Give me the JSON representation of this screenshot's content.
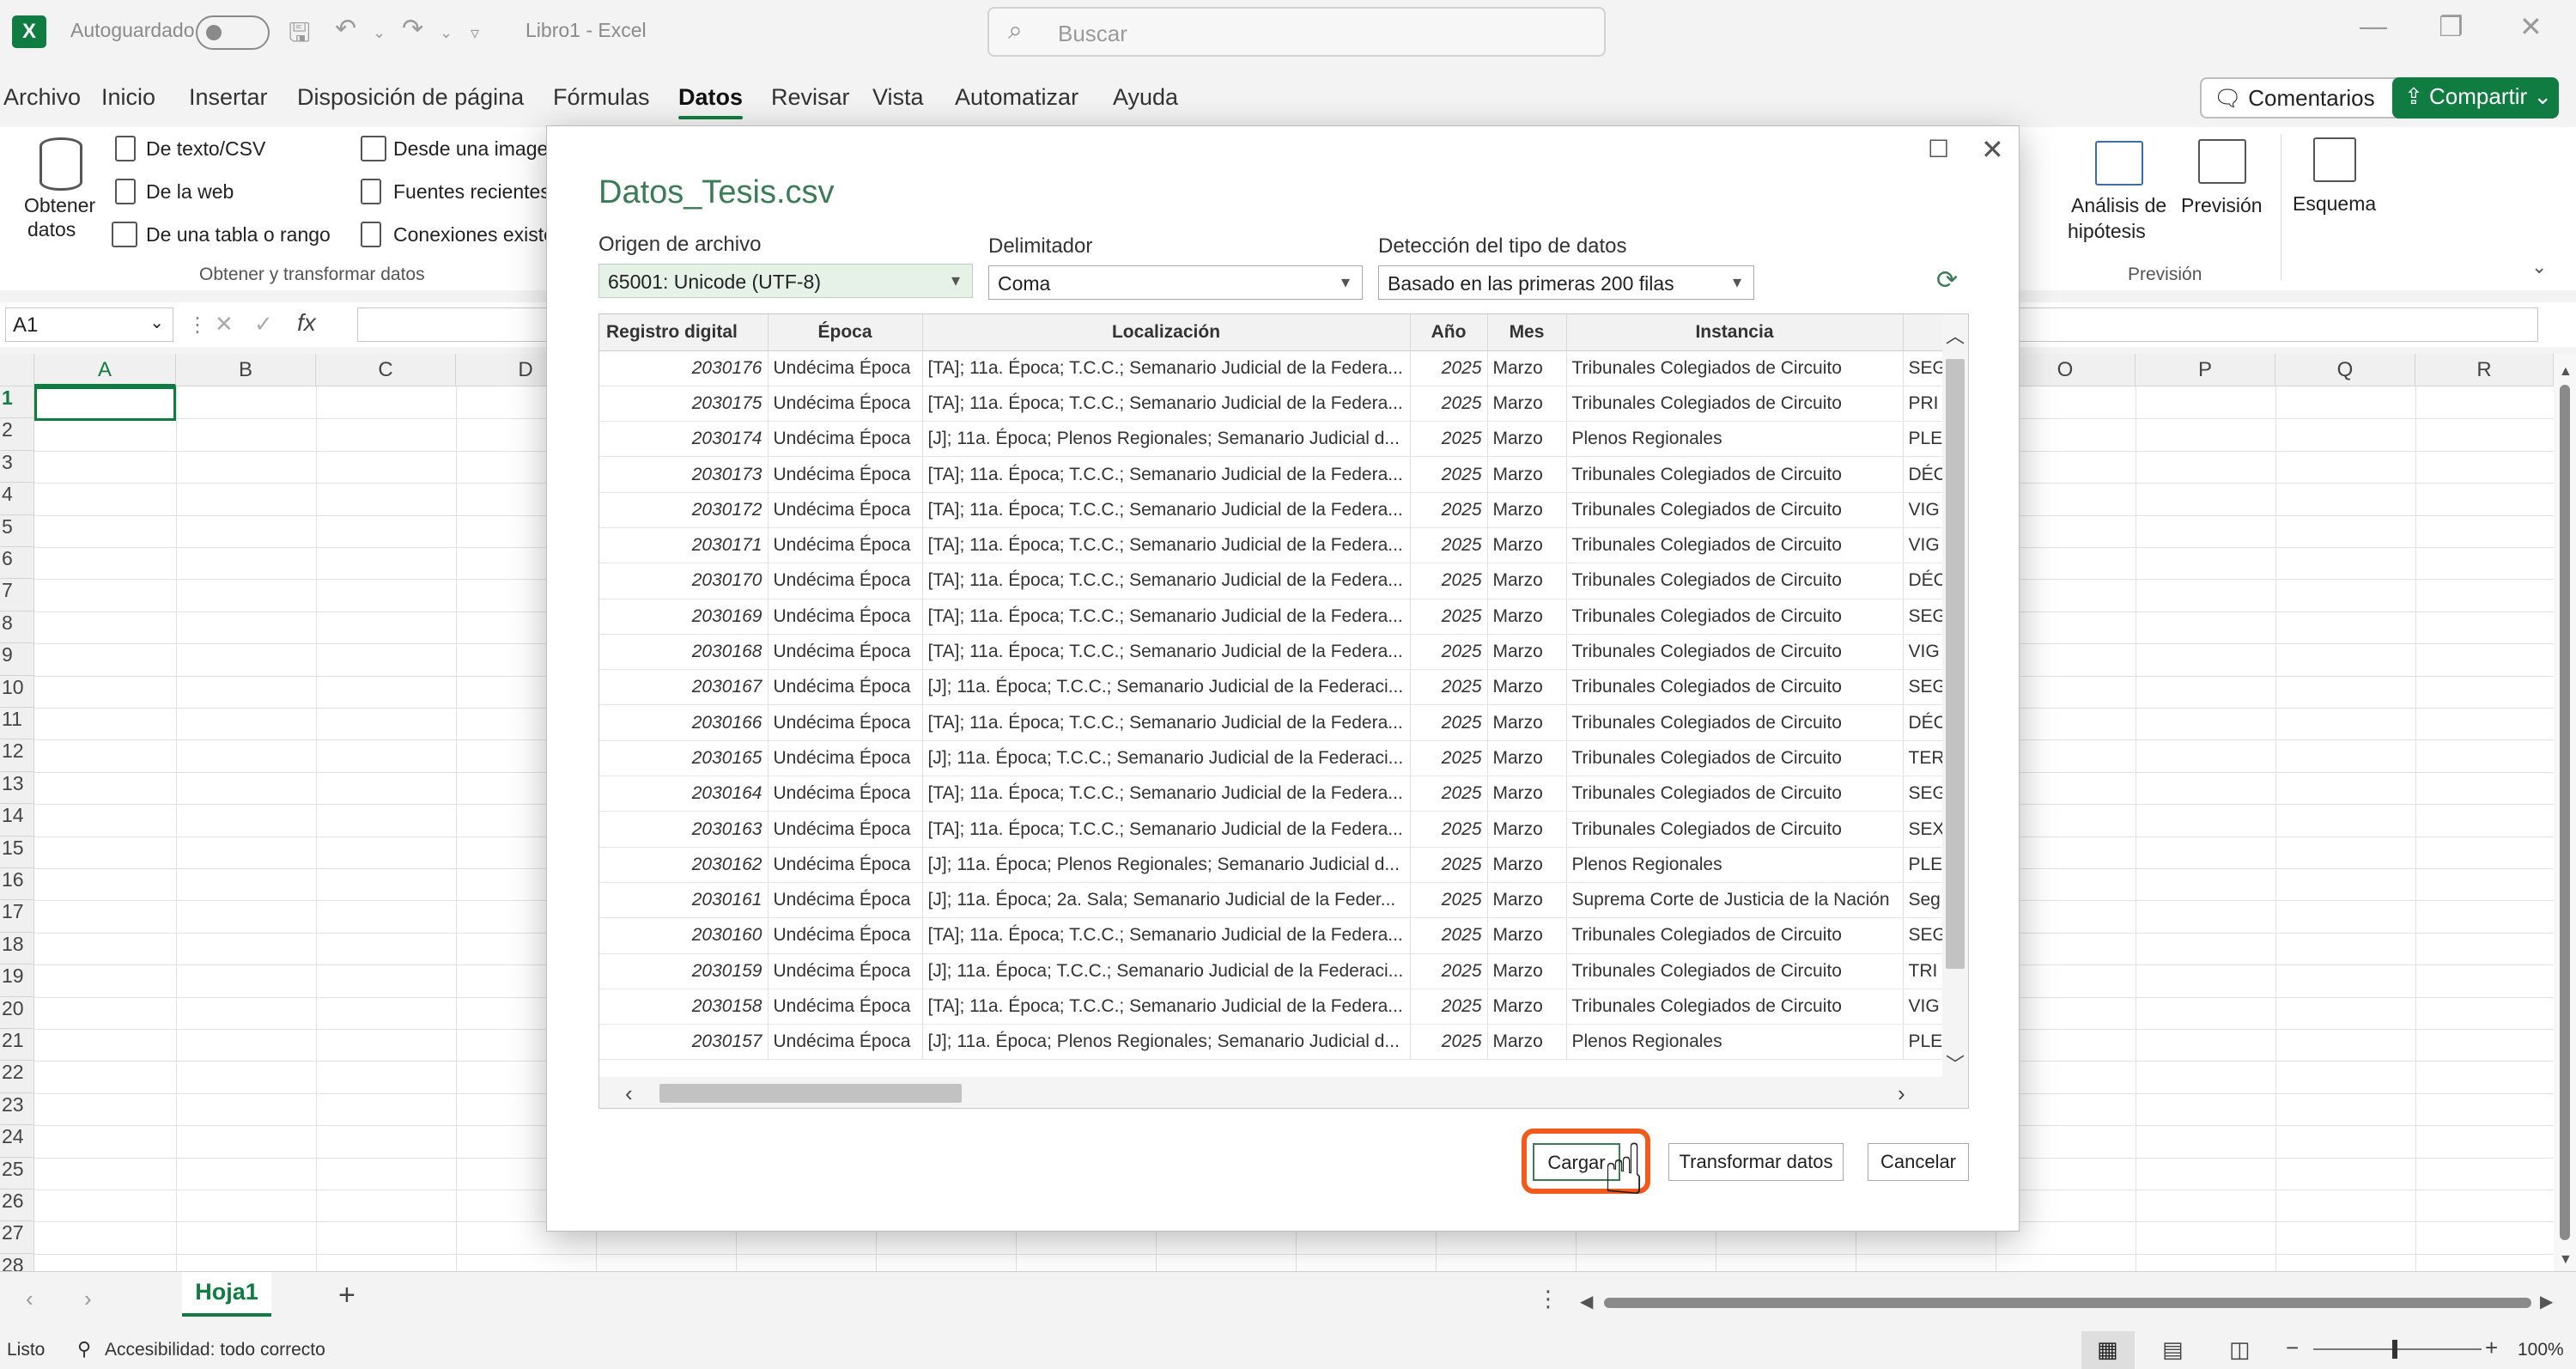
{
  "titlebar": {
    "autosave_label": "Autoguardado",
    "doc_title": "Libro1  -  Excel",
    "search_placeholder": "Buscar",
    "logo": "X"
  },
  "tabs": [
    "Archivo",
    "Inicio",
    "Insertar",
    "Disposición de página",
    "Fórmulas",
    "Datos",
    "Revisar",
    "Vista",
    "Automatizar",
    "Ayuda"
  ],
  "active_tab": "Datos",
  "header_buttons": {
    "comments": "Comentarios",
    "share": "Compartir"
  },
  "ribbon": {
    "get_data": "Obtener",
    "get_data2": "datos",
    "from_text": "De texto/CSV",
    "from_web": "De la web",
    "from_table": "De una tabla o rango",
    "from_image": "Desde una imagen",
    "recent_sources": "Fuentes recientes",
    "existing_conn": "Conexiones existentes",
    "group_get": "Obtener y transformar datos",
    "whatif": "Análisis de",
    "whatif2": "hipótesis",
    "forecast": "Previsión",
    "outline": "Esquema",
    "group_forecast": "Previsión"
  },
  "formula_bar": {
    "namebox": "A1",
    "fx": "fx"
  },
  "grid": {
    "columns": [
      "A",
      "B",
      "C",
      "D",
      "O",
      "P",
      "Q",
      "R"
    ],
    "rows": [
      "1",
      "2",
      "3",
      "4",
      "5",
      "6",
      "7",
      "8",
      "9",
      "10",
      "11",
      "12",
      "13",
      "14",
      "15",
      "16",
      "17",
      "18",
      "19",
      "20",
      "21",
      "22",
      "23",
      "24",
      "25",
      "26",
      "27",
      "28"
    ]
  },
  "sheetbar": {
    "sheet": "Hoja1",
    "add": "+"
  },
  "statusbar": {
    "ready": "Listo",
    "accessibility": "Accesibilidad: todo correcto",
    "zoom": "100%"
  },
  "dialog": {
    "title": "Datos_Tesis.csv",
    "origin_label": "Origen de archivo",
    "origin_value": "65001: Unicode (UTF-8)",
    "delim_label": "Delimitador",
    "delim_value": "Coma",
    "detect_label": "Detección del tipo de datos",
    "detect_value": "Basado en las primeras 200 filas",
    "columns": [
      "Registro digital",
      "Época",
      "Localización",
      "Año",
      "Mes",
      "Instancia",
      ""
    ],
    "rows": [
      [
        "2030176",
        "Undécima Época",
        "[TA]; 11a. Época; T.C.C.; Semanario Judicial de la Federa...",
        "2025",
        "Marzo",
        "Tribunales Colegiados de Circuito",
        "SEG"
      ],
      [
        "2030175",
        "Undécima Época",
        "[TA]; 11a. Época; T.C.C.; Semanario Judicial de la Federa...",
        "2025",
        "Marzo",
        "Tribunales Colegiados de Circuito",
        "PRI"
      ],
      [
        "2030174",
        "Undécima Época",
        "[J]; 11a. Época; Plenos Regionales; Semanario Judicial d...",
        "2025",
        "Marzo",
        "Plenos Regionales",
        "PLE"
      ],
      [
        "2030173",
        "Undécima Época",
        "[TA]; 11a. Época; T.C.C.; Semanario Judicial de la Federa...",
        "2025",
        "Marzo",
        "Tribunales Colegiados de Circuito",
        "DÉC"
      ],
      [
        "2030172",
        "Undécima Época",
        "[TA]; 11a. Época; T.C.C.; Semanario Judicial de la Federa...",
        "2025",
        "Marzo",
        "Tribunales Colegiados de Circuito",
        "VIG"
      ],
      [
        "2030171",
        "Undécima Época",
        "[TA]; 11a. Época; T.C.C.; Semanario Judicial de la Federa...",
        "2025",
        "Marzo",
        "Tribunales Colegiados de Circuito",
        "VIG"
      ],
      [
        "2030170",
        "Undécima Época",
        "[TA]; 11a. Época; T.C.C.; Semanario Judicial de la Federa...",
        "2025",
        "Marzo",
        "Tribunales Colegiados de Circuito",
        "DÉC"
      ],
      [
        "2030169",
        "Undécima Época",
        "[TA]; 11a. Época; T.C.C.; Semanario Judicial de la Federa...",
        "2025",
        "Marzo",
        "Tribunales Colegiados de Circuito",
        "SEG"
      ],
      [
        "2030168",
        "Undécima Época",
        "[TA]; 11a. Época; T.C.C.; Semanario Judicial de la Federa...",
        "2025",
        "Marzo",
        "Tribunales Colegiados de Circuito",
        "VIG"
      ],
      [
        "2030167",
        "Undécima Época",
        "[J]; 11a. Época; T.C.C.; Semanario Judicial de la Federaci...",
        "2025",
        "Marzo",
        "Tribunales Colegiados de Circuito",
        "SEG"
      ],
      [
        "2030166",
        "Undécima Época",
        "[TA]; 11a. Época; T.C.C.; Semanario Judicial de la Federa...",
        "2025",
        "Marzo",
        "Tribunales Colegiados de Circuito",
        "DÉC"
      ],
      [
        "2030165",
        "Undécima Época",
        "[J]; 11a. Época; T.C.C.; Semanario Judicial de la Federaci...",
        "2025",
        "Marzo",
        "Tribunales Colegiados de Circuito",
        "TER"
      ],
      [
        "2030164",
        "Undécima Época",
        "[TA]; 11a. Época; T.C.C.; Semanario Judicial de la Federa...",
        "2025",
        "Marzo",
        "Tribunales Colegiados de Circuito",
        "SEG"
      ],
      [
        "2030163",
        "Undécima Época",
        "[TA]; 11a. Época; T.C.C.; Semanario Judicial de la Federa...",
        "2025",
        "Marzo",
        "Tribunales Colegiados de Circuito",
        "SEX"
      ],
      [
        "2030162",
        "Undécima Época",
        "[J]; 11a. Época; Plenos Regionales; Semanario Judicial d...",
        "2025",
        "Marzo",
        "Plenos Regionales",
        "PLE"
      ],
      [
        "2030161",
        "Undécima Época",
        "[J]; 11a. Época; 2a. Sala; Semanario Judicial de la Feder...",
        "2025",
        "Marzo",
        "Suprema Corte de Justicia de la Nación",
        "Seg"
      ],
      [
        "2030160",
        "Undécima Época",
        "[TA]; 11a. Época; T.C.C.; Semanario Judicial de la Federa...",
        "2025",
        "Marzo",
        "Tribunales Colegiados de Circuito",
        "SEG"
      ],
      [
        "2030159",
        "Undécima Época",
        "[J]; 11a. Época; T.C.C.; Semanario Judicial de la Federaci...",
        "2025",
        "Marzo",
        "Tribunales Colegiados de Circuito",
        "TRI"
      ],
      [
        "2030158",
        "Undécima Época",
        "[TA]; 11a. Época; T.C.C.; Semanario Judicial de la Federa...",
        "2025",
        "Marzo",
        "Tribunales Colegiados de Circuito",
        "VIG"
      ],
      [
        "2030157",
        "Undécima Época",
        "[J]; 11a. Época; Plenos Regionales; Semanario Judicial d...",
        "2025",
        "Marzo",
        "Plenos Regionales",
        "PLE"
      ]
    ],
    "btn_load": "Cargar",
    "btn_transform": "Transformar datos",
    "btn_cancel": "Cancelar"
  },
  "colors": {
    "excel_green": "#107c41",
    "highlight": "#f25a1c",
    "title_green": "#3b7b56"
  }
}
